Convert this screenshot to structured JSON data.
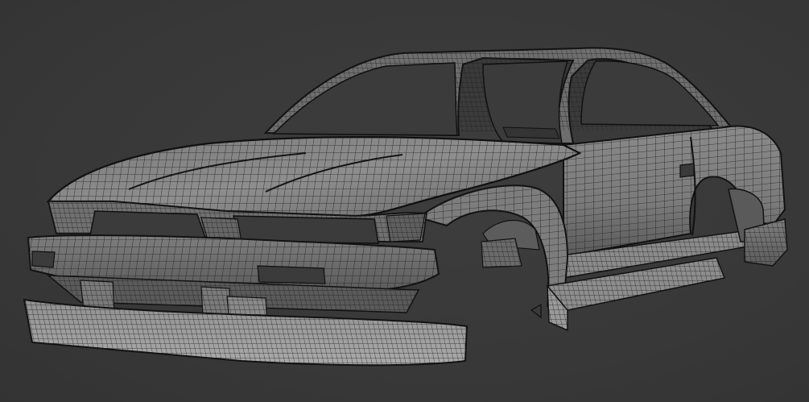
{
  "scene": {
    "subject": "car-body-wireframe-render",
    "colors": {
      "background": "#3a3a3a",
      "surface_light": "#8c8c8c",
      "surface_mid": "#6f6f6f",
      "surface_dark": "#4a4a4a",
      "wire": "#1e1e1e",
      "outline": "#121212"
    }
  }
}
